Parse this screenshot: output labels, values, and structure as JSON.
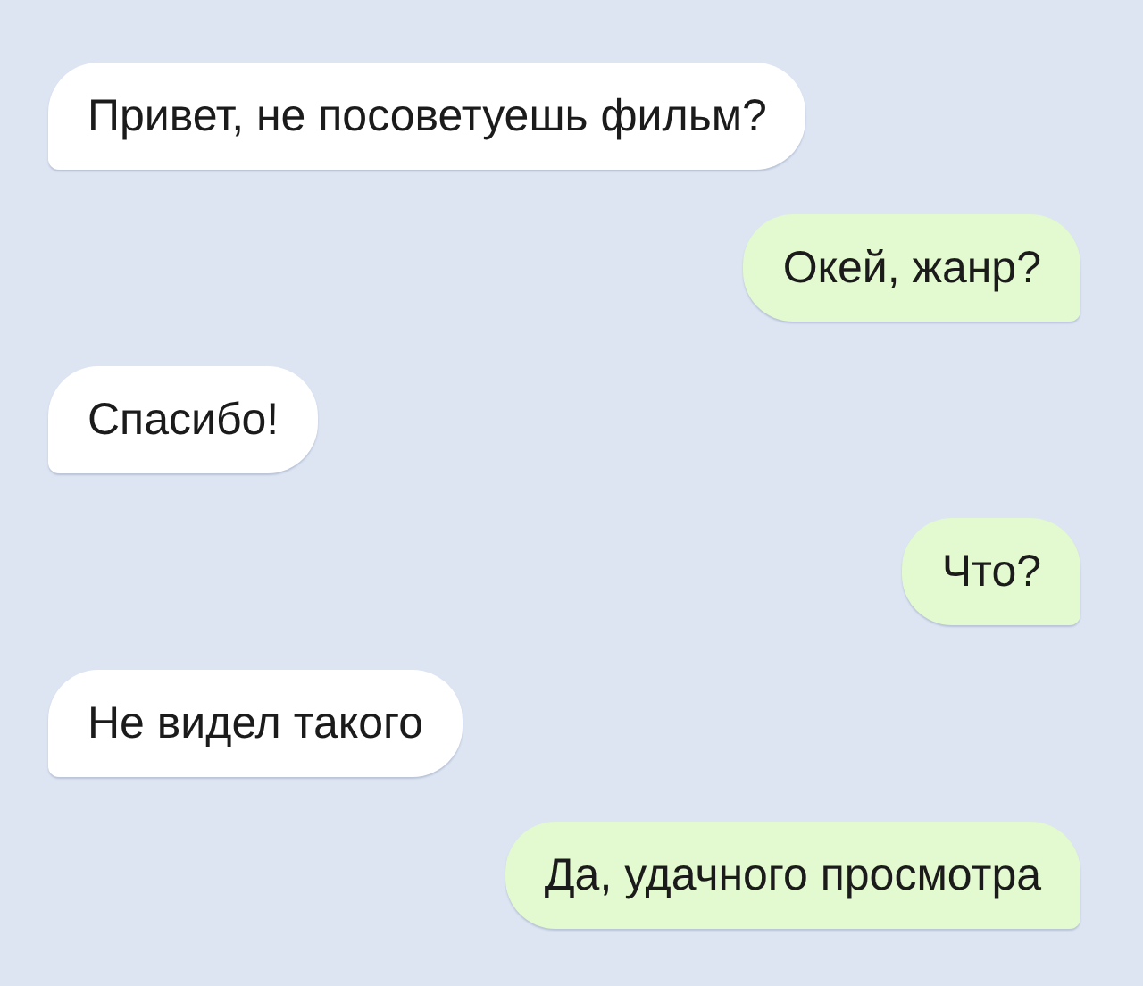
{
  "messages": [
    {
      "kind": "incoming",
      "text": "Привет, не посоветуешь фильм?"
    },
    {
      "kind": "outgoing",
      "text": "Окей, жанр?"
    },
    {
      "kind": "incoming",
      "text": "Спасибо!"
    },
    {
      "kind": "outgoing",
      "text": "Что?"
    },
    {
      "kind": "incoming",
      "text": "Не видел такого"
    },
    {
      "kind": "outgoing",
      "text": "Да, удачного просмотра"
    }
  ]
}
